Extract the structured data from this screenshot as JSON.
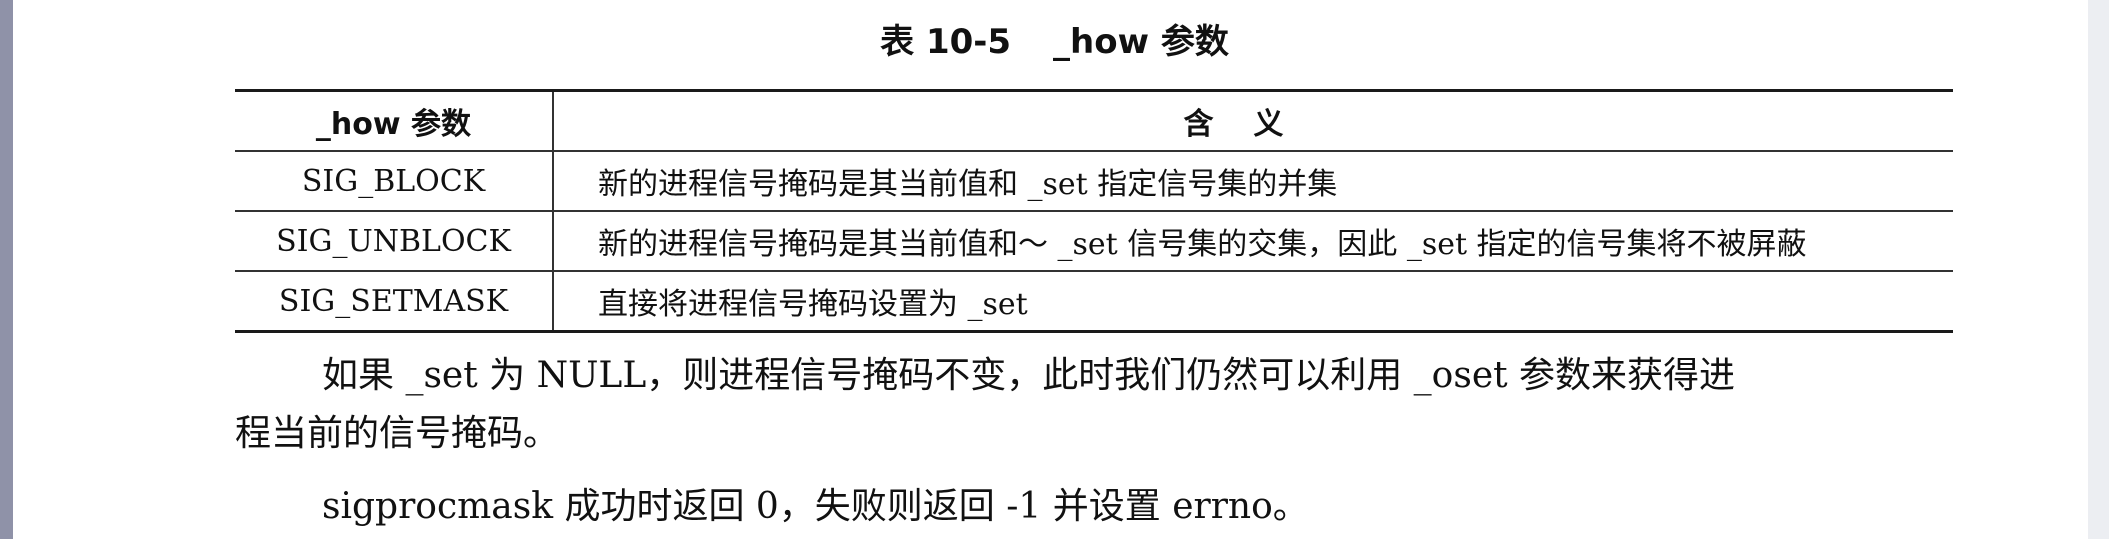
{
  "caption": {
    "number": "表 10-5",
    "title": "_how 参数"
  },
  "table": {
    "headers": [
      "_how 参数",
      "含义"
    ],
    "rows": [
      {
        "param": "SIG_BLOCK",
        "meaning": "新的进程信号掩码是其当前值和 _set 指定信号集的并集"
      },
      {
        "param": "SIG_UNBLOCK",
        "meaning": "新的进程信号掩码是其当前值和～ _set 信号集的交集，因此 _set 指定的信号集将不被屏蔽"
      },
      {
        "param": "SIG_SETMASK",
        "meaning": "直接将进程信号掩码设置为 _set"
      }
    ]
  },
  "paragraphs": {
    "p1_line1": "如果 _set 为 NULL，则进程信号掩码不变，此时我们仍然可以利用 _oset 参数来获得进",
    "p1_line2": "程当前的信号掩码。",
    "p2": "sigprocmask 成功时返回 0，失败则返回 -1 并设置 errno。"
  }
}
